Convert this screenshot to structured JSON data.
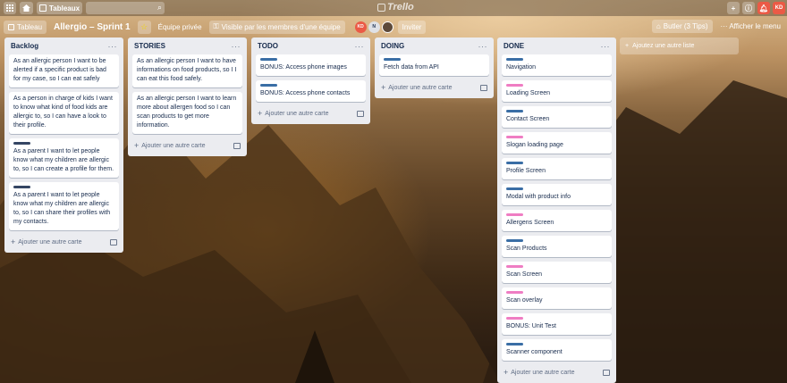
{
  "header": {
    "boards_label": "Tableaux",
    "logo_text": "Trello",
    "user_initials": "KD"
  },
  "boardbar": {
    "boards_link": "Tableau",
    "title": "Allergio – Sprint 1",
    "team": "Équipe privée",
    "visibility": "Visible par les membres d'une équipe",
    "members": [
      "KD",
      "N",
      ""
    ],
    "invite": "Inviter",
    "butler": "Butler (3 Tips)",
    "show_menu": "Afficher le menu"
  },
  "colors": {
    "blue_label": "#3a6ea5",
    "pink_label": "#ef7dc3",
    "dark_label": "#344563",
    "header_bg": "#2c2014"
  },
  "lists": [
    {
      "title": "Backlog",
      "cards": [
        {
          "text": "As an allergic person I want to be alerted if a specific product is bad for my case, so I can eat safely"
        },
        {
          "text": "As a person in charge of kids I want to know what kind of food kids are allergic to, so I can have a look to their profile."
        },
        {
          "label": "dark",
          "text": "As a parent I want to let people know what my children are allergic to, so I can create a profile for them."
        },
        {
          "label": "dark",
          "text": "As a parent I want to let people know what my children are allergic to, so I can share their profiles with my contacts."
        }
      ],
      "add": "Ajouter une autre carte"
    },
    {
      "title": "STORIES",
      "cards": [
        {
          "text": "As an allergic person I want to have informations on food products, so I I can eat this food safely."
        },
        {
          "text": "As an allergic person I want to learn more about allergen food so I can scan products to get more information."
        }
      ],
      "add": "Ajouter une autre carte"
    },
    {
      "title": "TODO",
      "cards": [
        {
          "label": "blue",
          "text": "BONUS: Access phone images"
        },
        {
          "label": "blue",
          "text": "BONUS: Access phone contacts"
        }
      ],
      "add": "Ajouter une autre carte"
    },
    {
      "title": "DOING",
      "cards": [
        {
          "label": "blue",
          "text": "Fetch data from API"
        }
      ],
      "add": "Ajouter une autre carte"
    },
    {
      "title": "DONE",
      "cards": [
        {
          "label": "blue",
          "text": "Navigation"
        },
        {
          "label": "pink",
          "text": "Loading Screen"
        },
        {
          "label": "blue",
          "text": "Contact Screen"
        },
        {
          "label": "pink",
          "text": "Slogan loading page"
        },
        {
          "label": "blue",
          "text": "Profile Screen"
        },
        {
          "label": "blue",
          "text": "Modal with product info"
        },
        {
          "label": "pink",
          "text": "Allergens Screen"
        },
        {
          "label": "blue",
          "text": "Scan Products"
        },
        {
          "label": "pink",
          "text": "Scan Screen"
        },
        {
          "label": "pink",
          "text": "Scan overlay"
        },
        {
          "label": "pink",
          "text": "BONUS: Unit Test"
        },
        {
          "label": "blue",
          "text": "Scanner component"
        }
      ],
      "add": "Ajouter une autre carte"
    }
  ],
  "add_list": "Ajoutez une autre liste"
}
